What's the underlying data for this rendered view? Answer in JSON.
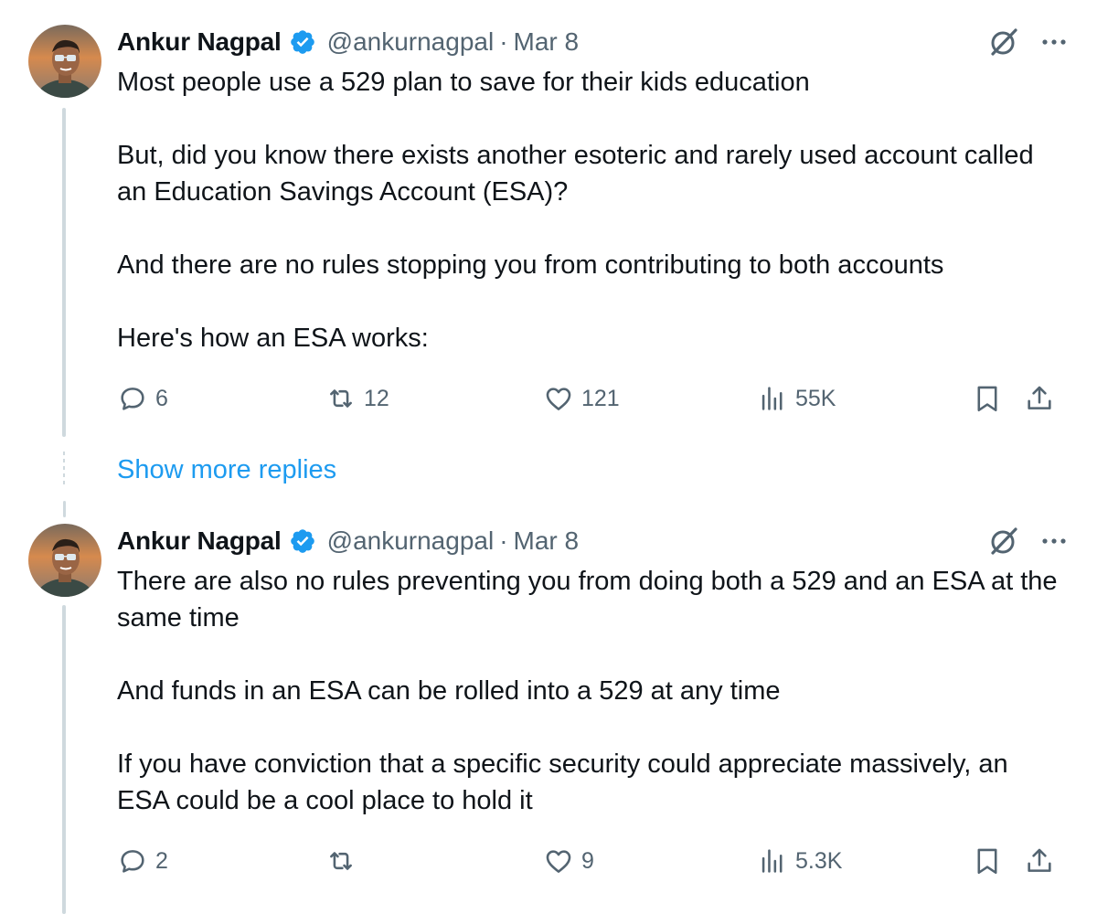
{
  "colors": {
    "accent": "#1d9bf0",
    "secondary_text": "#536471",
    "primary_text": "#0f1419",
    "thread_line": "#cfd9de"
  },
  "tweets": [
    {
      "name": "Ankur Nagpal",
      "handle": "@ankurnagpal",
      "separator": "·",
      "date": "Mar 8",
      "paragraphs": [
        "Most people use a 529 plan to save for their kids education",
        "But, did you know there exists another esoteric and rarely used account called an Education Savings Account (ESA)?",
        "And there are no rules stopping you from contributing to both accounts",
        "Here's how an ESA works:"
      ],
      "replies": "6",
      "reposts": "12",
      "likes": "121",
      "views": "55K"
    },
    {
      "name": "Ankur Nagpal",
      "handle": "@ankurnagpal",
      "separator": "·",
      "date": "Mar 8",
      "paragraphs": [
        "There are also no rules preventing you from doing both a 529 and an ESA at the same time",
        "And funds in an ESA can be rolled into a 529 at any time",
        "If you have conviction that a specific security could appreciate massively, an ESA could be a cool place to hold it"
      ],
      "replies": "2",
      "reposts": "",
      "likes": "9",
      "views": "5.3K"
    }
  ],
  "show_more_replies": "Show more replies",
  "icons": [
    "verified-badge-icon",
    "grok-icon",
    "more-icon",
    "reply-icon",
    "repost-icon",
    "like-icon",
    "views-icon",
    "bookmark-icon",
    "share-icon"
  ]
}
